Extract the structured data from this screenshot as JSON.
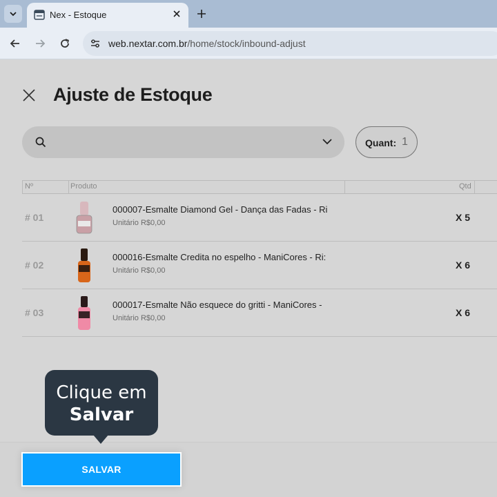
{
  "browser": {
    "tab_title": "Nex - Estoque",
    "url_host": "web.nextar.com.br",
    "url_path": "/home/stock/inbound-adjust"
  },
  "page": {
    "title": "Ajuste de Estoque",
    "search": {
      "value": "",
      "placeholder": ""
    },
    "quant_label": "Quant:",
    "quant_value": "1"
  },
  "table": {
    "headers": {
      "num": "Nº",
      "product": "Produto",
      "qty": "Qtd"
    },
    "rows": [
      {
        "num": "# 01",
        "name": "000007-Esmalte Diamond Gel - Dança das Fadas - Ri",
        "price": "Unitário R$0,00",
        "qty": "X 5",
        "bottle_color": "#c9a0a6",
        "cap_color": "#d8b8bd"
      },
      {
        "num": "# 02",
        "name": "000016-Esmalte Credita no espelho - ManiCores - Ri:",
        "price": "Unitário R$0,00",
        "qty": "X 6",
        "bottle_color": "#d8661a",
        "cap_color": "#2a1a10"
      },
      {
        "num": "# 03",
        "name": "000017-Esmalte Não esquece do gritti - ManiCores -",
        "price": "Unitário R$0,00",
        "qty": "X 6",
        "bottle_color": "#f08aa6",
        "cap_color": "#2a1a1a"
      }
    ]
  },
  "footer": {
    "save_label": "SALVAR"
  },
  "tooltip": {
    "line1": "Clique em",
    "line2": "Salvar"
  },
  "colors": {
    "accent": "#0aa0ff",
    "tooltip_bg": "#2b3743"
  }
}
